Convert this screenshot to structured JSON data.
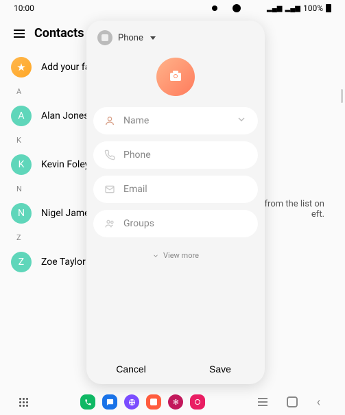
{
  "status": {
    "time": "10:00",
    "battery": "100%"
  },
  "header": {
    "title": "Contacts"
  },
  "list": {
    "favorites": "Add your favorites",
    "sections": [
      {
        "letter": "A",
        "name": "Alan Jones",
        "initial": "A"
      },
      {
        "letter": "K",
        "name": "Kevin Foley",
        "initial": "K"
      },
      {
        "letter": "N",
        "name": "Nigel James",
        "initial": "N"
      },
      {
        "letter": "Z",
        "name": "Zoe Taylor",
        "initial": "Z"
      }
    ]
  },
  "hint": {
    "line1": "from the list on",
    "line2": "eft."
  },
  "modal": {
    "storage": "Phone",
    "fields": {
      "name": "Name",
      "phone": "Phone",
      "email": "Email",
      "groups": "Groups"
    },
    "viewMore": "View more",
    "cancel": "Cancel",
    "save": "Save"
  }
}
